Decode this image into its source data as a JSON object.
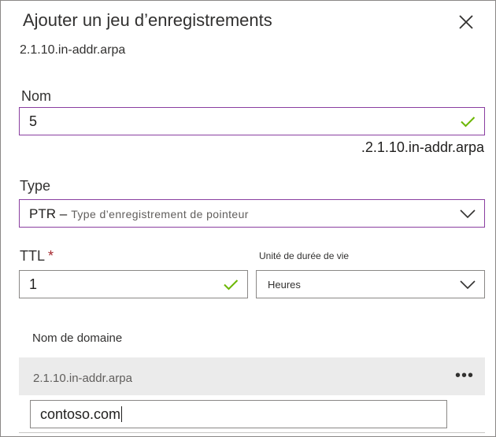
{
  "panel": {
    "title": "Ajouter un jeu d’enregistrements",
    "subtitle": "2.1.10.in-addr.arpa"
  },
  "name_field": {
    "label": "Nom",
    "value": "5",
    "suffix": ".2.1.10.in-addr.arpa",
    "valid_icon": "checkmark-icon"
  },
  "type_field": {
    "label": "Type",
    "value": "PTR –",
    "description": "Type d’enregistrement de pointeur",
    "icon": "chevron-down-icon"
  },
  "ttl_field": {
    "label": "TTL",
    "required_marker": "*",
    "value": "1",
    "valid_icon": "checkmark-icon"
  },
  "ttl_unit_field": {
    "label": "Unité de durée de vie",
    "value": "Heures",
    "icon": "chevron-down-icon"
  },
  "domain_section": {
    "header": "Nom de domaine",
    "zone": "2.1.10.in-addr.arpa",
    "more_label": "•••",
    "input_value": "contoso.com"
  },
  "colors": {
    "focus_border": "#8a3ea0",
    "valid_check": "#6bb700",
    "required": "#a4262c"
  }
}
